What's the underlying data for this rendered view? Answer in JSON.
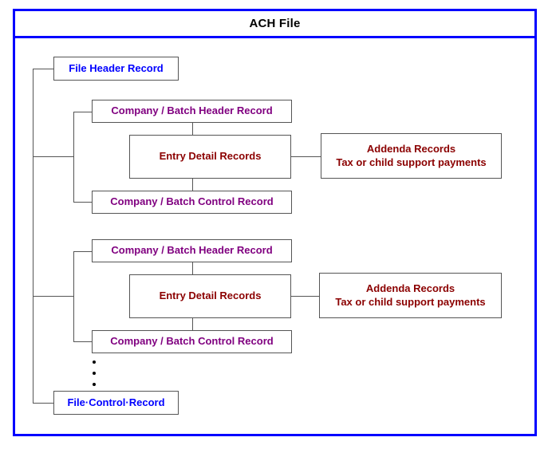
{
  "diagram": {
    "title": "ACH File",
    "colors": {
      "frame": "#0000ff",
      "file_record_text": "#0000ff",
      "batch_record_text": "#800080",
      "entry_record_text": "#8b0000",
      "box_border": "#555555",
      "connector": "#555555",
      "title_text": "#000000",
      "background": "#ffffff"
    },
    "nodes": {
      "file_header": "File Header Record",
      "file_control": "File·Control·Record",
      "batch_header": "Company / Batch Header Record",
      "batch_control": "Company / Batch Control Record",
      "entry_detail": "Entry Detail Records",
      "addenda_line1": "Addenda Records",
      "addenda_line2": "Tax or child support payments"
    },
    "batches": [
      {
        "header": "Company / Batch Header Record",
        "entry": "Entry Detail Records",
        "control": "Company / Batch Control Record",
        "addenda_line1": "Addenda Records",
        "addenda_line2": "Tax or child support payments"
      },
      {
        "header": "Company / Batch Header Record",
        "entry": "Entry Detail Records",
        "control": "Company / Batch Control Record",
        "addenda_line1": "Addenda Records",
        "addenda_line2": "Tax or child support payments"
      }
    ],
    "continuation_marker": "⋮"
  }
}
